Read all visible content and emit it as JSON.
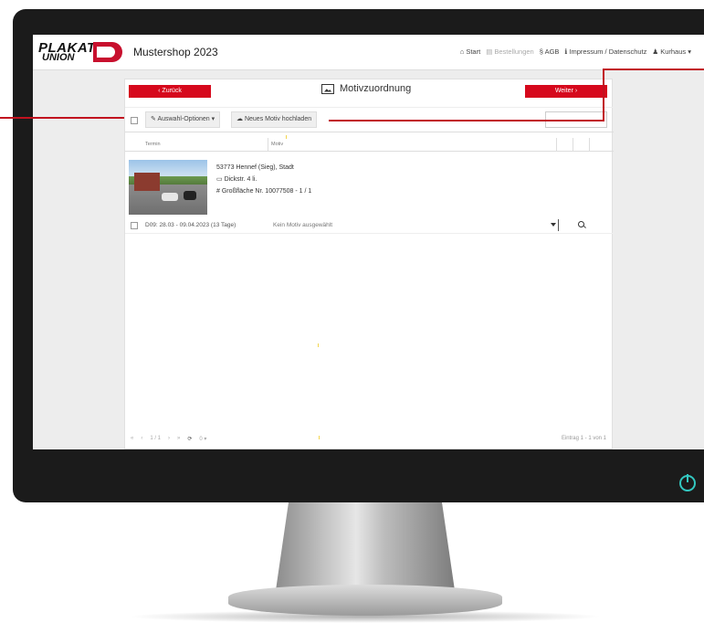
{
  "header": {
    "logo_line1": "PLAKAT",
    "logo_line2": "UNION",
    "shop_title": "Mustershop 2023",
    "nav": [
      "Start",
      "Bestellungen",
      "AGB",
      "Impressum / Datenschutz",
      "Kurhaus"
    ]
  },
  "panel": {
    "back_label": "‹ Zurück",
    "next_label": "Weiter ›",
    "title": "Motivzuordnung",
    "toolbar": {
      "select_options_label": "Auswahl-Optionen",
      "upload_label": "Neues Motiv hochladen"
    },
    "table": {
      "headers": [
        "Termin",
        "Motiv"
      ],
      "row": {
        "location": "53773 Hennef (Sieg), Stadt",
        "street": "Dickstr. 4 li.",
        "board": "Großfläche Nr. 10077508 - 1 / 1",
        "date": "D09: 28.03 - 09.04.2023 (13 Tage)",
        "motiv_placeholder": "Kein Motiv ausgewählt"
      }
    },
    "pager": {
      "first": "«",
      "prev": "‹",
      "page": "1 / 1",
      "next": "›",
      "last": "»",
      "size": "0",
      "entries": "Eintrag 1 - 1 von 1"
    }
  },
  "colors": {
    "accent": "#d6081c",
    "bezel": "#1b1b1b",
    "power": "#33c7c0"
  }
}
